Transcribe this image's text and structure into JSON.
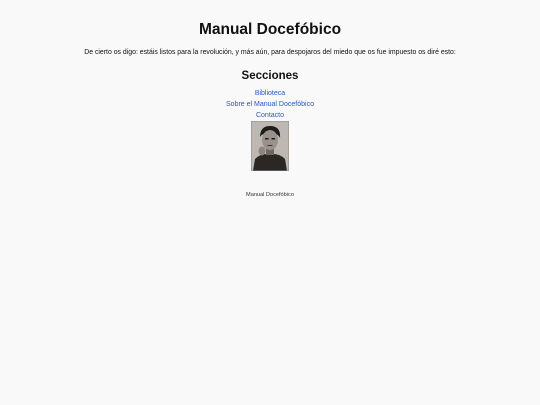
{
  "header": {
    "title": "Manual Docefóbico"
  },
  "main": {
    "intro": "De cierto os digo: estáis listos para la revolución, y más aún, para despojaros del miedo que os fue impuesto os diré esto:",
    "sections_heading": "Secciones",
    "nav": [
      {
        "label": "Biblioteca"
      },
      {
        "label": "Sobre el Manual Docefóbico"
      },
      {
        "label": "Contacto"
      }
    ],
    "portrait": {
      "icon": "portrait-photo"
    }
  },
  "footer": {
    "text": "Manual Docefóbico"
  },
  "colors": {
    "background": "#f9f9f9",
    "link": "#2a58c9",
    "text": "#111111"
  }
}
